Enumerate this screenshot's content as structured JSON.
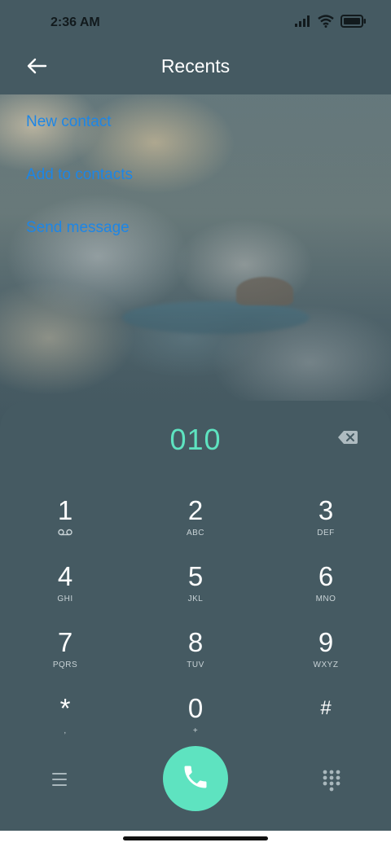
{
  "status_bar": {
    "time": "2:36 AM",
    "icons": [
      "signal-icon",
      "wifi-icon",
      "battery-icon"
    ]
  },
  "header": {
    "back_icon": "back-arrow-icon",
    "title": "Recents"
  },
  "options": [
    {
      "label": "New contact"
    },
    {
      "label": "Add to contacts"
    },
    {
      "label": "Send message"
    }
  ],
  "dialpad": {
    "number": "010",
    "backspace_icon": "backspace-icon",
    "keys": [
      {
        "digit": "1",
        "letters": "",
        "icon": "voicemail-icon"
      },
      {
        "digit": "2",
        "letters": "ABC"
      },
      {
        "digit": "3",
        "letters": "DEF"
      },
      {
        "digit": "4",
        "letters": "GHI"
      },
      {
        "digit": "5",
        "letters": "JKL"
      },
      {
        "digit": "6",
        "letters": "MNO"
      },
      {
        "digit": "7",
        "letters": "PQRS"
      },
      {
        "digit": "8",
        "letters": "TUV"
      },
      {
        "digit": "9",
        "letters": "WXYZ"
      },
      {
        "digit": "*",
        "letters": ","
      },
      {
        "digit": "0",
        "letters": "+"
      },
      {
        "digit": "#",
        "letters": ""
      }
    ],
    "menu_icon": "menu-icon",
    "call_icon": "phone-icon",
    "keypad_icon": "dialpad-icon"
  },
  "colors": {
    "background": "#455a62",
    "accent": "#5ee3c0",
    "link": "#1d86e6"
  }
}
